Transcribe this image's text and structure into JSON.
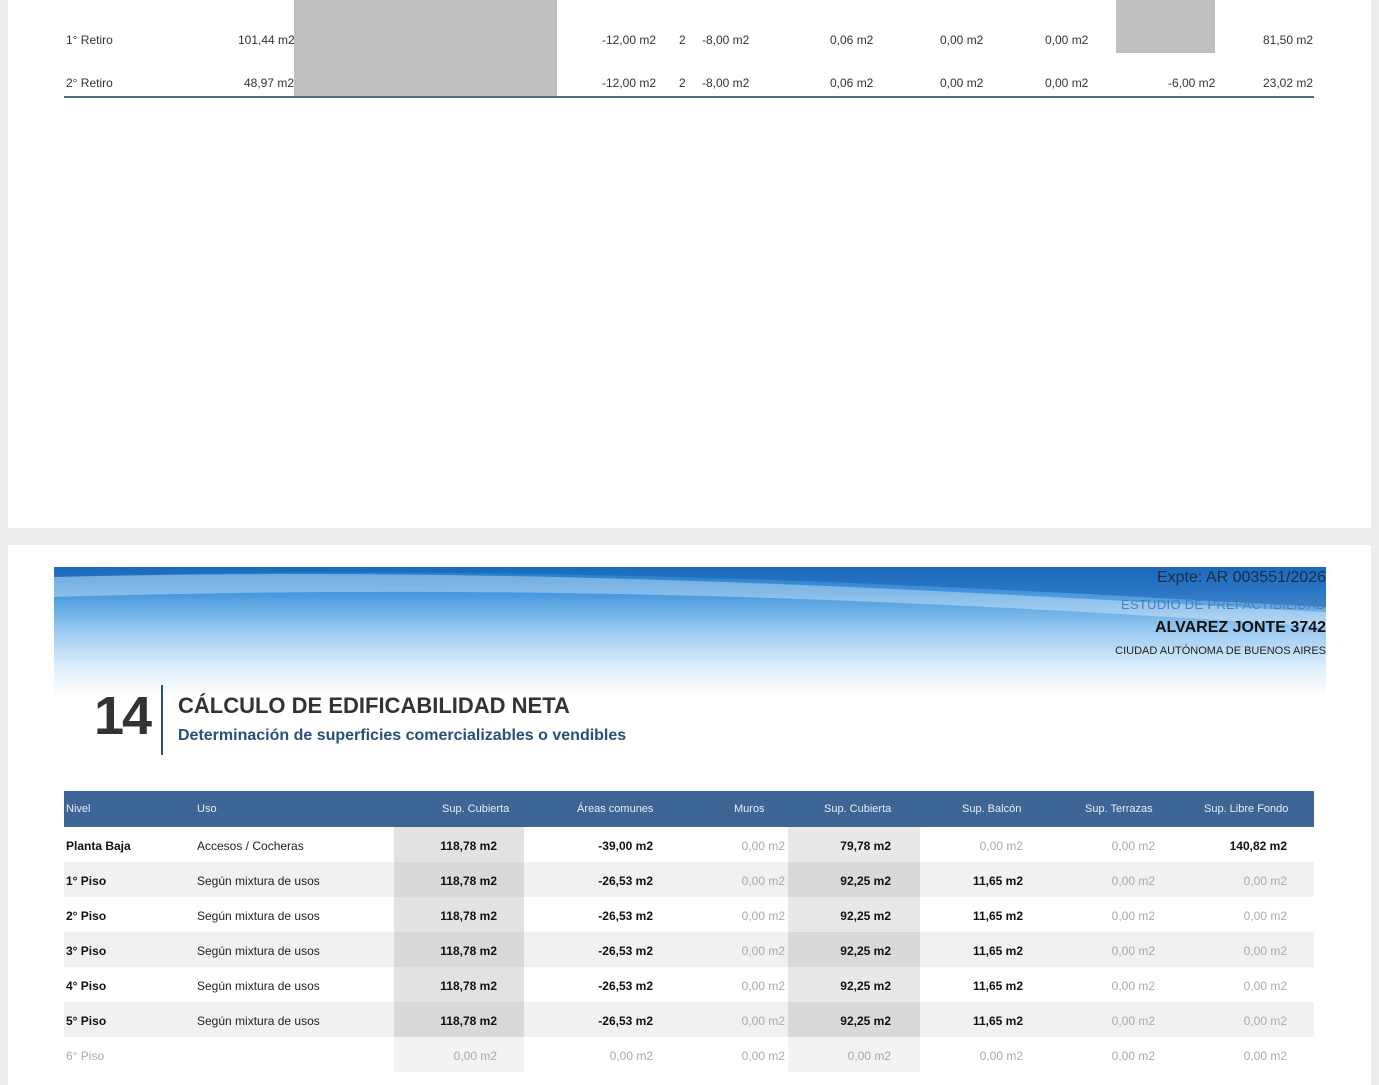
{
  "top_table": {
    "rows": [
      {
        "label": "1° Retiro",
        "area": "101,44 m2",
        "c1": "-12,00 m2",
        "n": "2",
        "c2": "-8,00 m2",
        "c3": "0,06 m2",
        "c4": "0,00 m2",
        "c5": "0,00 m2",
        "c6": "",
        "total": "81,50 m2"
      },
      {
        "label": "2° Retiro",
        "area": "48,97 m2",
        "c1": "-12,00 m2",
        "n": "2",
        "c2": "-8,00 m2",
        "c3": "0,06 m2",
        "c4": "0,00 m2",
        "c5": "0,00 m2",
        "c6": "-6,00 m2",
        "total": "23,02 m2"
      }
    ]
  },
  "header": {
    "expte": "Expte: AR 003551/2026",
    "estudio": "ESTUDIO DE PREFACTIBILIDAD",
    "address": "ALVAREZ JONTE 3742",
    "city": "CIUDAD AUTÓNOMA DE BUENOS AIRES"
  },
  "section": {
    "number": "14",
    "title": "CÁLCULO DE EDIFICABILIDAD NETA",
    "subtitle": "Determinación de superficies comercializables o vendibles"
  },
  "colors": {
    "header_bg": "#3d6596",
    "accent": "#2a4f7a"
  },
  "table": {
    "columns": [
      "Nivel",
      "Uso",
      "Sup. Cubierta",
      "Áreas comunes",
      "Muros",
      "Sup. Cubierta",
      "Sup. Balcón",
      "Sup. Terrazas",
      "Sup. Libre Fondo"
    ],
    "rows": [
      {
        "nivel": "Planta Baja",
        "uso": "Accesos / Cocheras",
        "v": [
          "118,78 m2",
          "-39,00 m2",
          "0,00 m2",
          "79,78 m2",
          "0,00 m2",
          "0,00 m2",
          "140,82 m2"
        ]
      },
      {
        "nivel": "1° Piso",
        "uso": "Según mixtura de usos",
        "v": [
          "118,78 m2",
          "-26,53 m2",
          "0,00 m2",
          "92,25 m2",
          "11,65 m2",
          "0,00 m2",
          "0,00 m2"
        ]
      },
      {
        "nivel": "2° Piso",
        "uso": "Según mixtura de usos",
        "v": [
          "118,78 m2",
          "-26,53 m2",
          "0,00 m2",
          "92,25 m2",
          "11,65 m2",
          "0,00 m2",
          "0,00 m2"
        ]
      },
      {
        "nivel": "3° Piso",
        "uso": "Según mixtura de usos",
        "v": [
          "118,78 m2",
          "-26,53 m2",
          "0,00 m2",
          "92,25 m2",
          "11,65 m2",
          "0,00 m2",
          "0,00 m2"
        ]
      },
      {
        "nivel": "4° Piso",
        "uso": "Según mixtura de usos",
        "v": [
          "118,78 m2",
          "-26,53 m2",
          "0,00 m2",
          "92,25 m2",
          "11,65 m2",
          "0,00 m2",
          "0,00 m2"
        ]
      },
      {
        "nivel": "5° Piso",
        "uso": "Según mixtura de usos",
        "v": [
          "118,78 m2",
          "-26,53 m2",
          "0,00 m2",
          "92,25 m2",
          "11,65 m2",
          "0,00 m2",
          "0,00 m2"
        ]
      },
      {
        "nivel": "6° Piso",
        "uso": "",
        "v": [
          "0,00 m2",
          "0,00 m2",
          "0,00 m2",
          "0,00 m2",
          "0,00 m2",
          "0,00 m2",
          "0,00 m2"
        ]
      }
    ]
  }
}
